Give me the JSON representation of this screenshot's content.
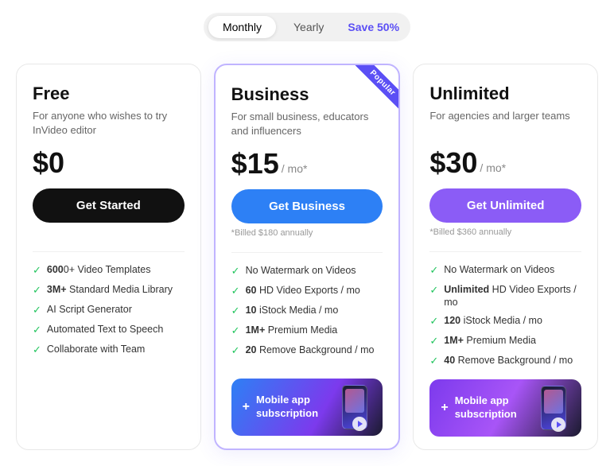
{
  "toggle": {
    "monthly_label": "Monthly",
    "yearly_label": "Yearly",
    "save_label": "Save 50%",
    "active": "yearly"
  },
  "cards": [
    {
      "id": "free",
      "title": "Free",
      "description": "For anyone who wishes to try InVideo editor",
      "price": "$0",
      "period": "",
      "button_label": "Get Started",
      "button_type": "dark",
      "billing_note": "",
      "popular": false,
      "features": [
        {
          "highlight": "600",
          "text": "0+ Video Templates"
        },
        {
          "highlight": "3M+",
          "text": " Standard Media Library"
        },
        {
          "highlight": "",
          "text": "AI Script Generator"
        },
        {
          "highlight": "",
          "text": "Automated Text to Speech"
        },
        {
          "highlight": "",
          "text": "Collaborate with Team"
        }
      ],
      "mobile_banner": false
    },
    {
      "id": "business",
      "title": "Business",
      "description": "For small business, educators and influencers",
      "price": "$15",
      "period": "/ mo*",
      "button_label": "Get Business",
      "button_type": "blue",
      "billing_note": "*Billed $180 annually",
      "popular": true,
      "features": [
        {
          "highlight": "",
          "text": "No Watermark on Videos"
        },
        {
          "highlight": "60",
          "text": " HD Video Exports / mo"
        },
        {
          "highlight": "10",
          "text": " iStock Media / mo"
        },
        {
          "highlight": "1M+",
          "text": " Premium Media"
        },
        {
          "highlight": "20",
          "text": " Remove Background / mo"
        }
      ],
      "mobile_banner": true,
      "banner_style": "blue",
      "banner_text": "Mobile app\nsubscription"
    },
    {
      "id": "unlimited",
      "title": "Unlimited",
      "description": "For agencies and larger teams",
      "price": "$30",
      "period": "/ mo*",
      "button_label": "Get Unlimited",
      "button_type": "purple",
      "billing_note": "*Billed $360 annually",
      "popular": false,
      "features": [
        {
          "highlight": "",
          "text": "No Watermark on Videos"
        },
        {
          "highlight": "Unlimited",
          "text": " HD Video Exports / mo"
        },
        {
          "highlight": "120",
          "text": " iStock Media / mo"
        },
        {
          "highlight": "1M+",
          "text": " Premium Media"
        },
        {
          "highlight": "40",
          "text": " Remove Background / mo"
        }
      ],
      "mobile_banner": true,
      "banner_style": "purple",
      "banner_text": "Mobile app\nsubscription"
    }
  ],
  "icons": {
    "check": "✓",
    "plus": "+",
    "play": "▶"
  }
}
